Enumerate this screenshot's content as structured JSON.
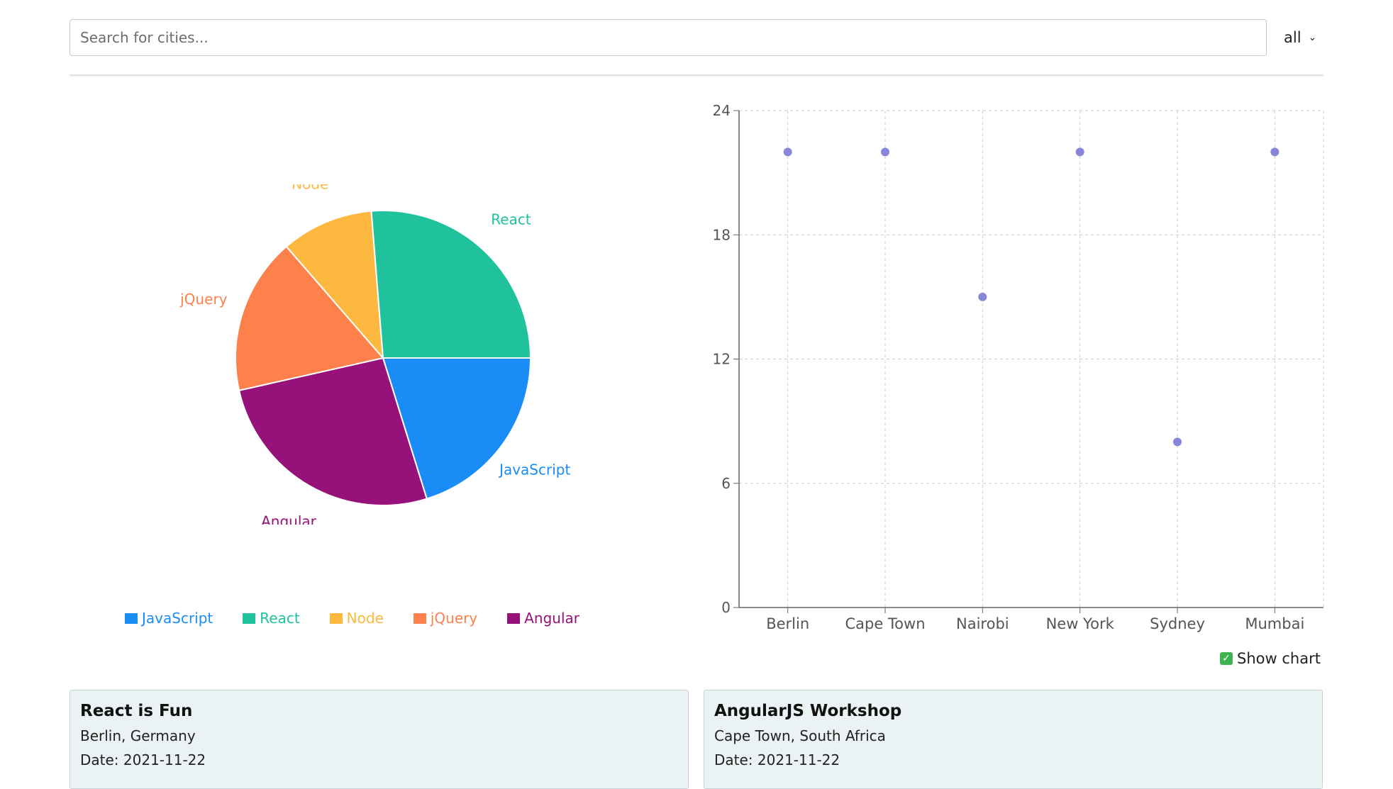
{
  "search": {
    "placeholder": "Search for cities..."
  },
  "filter": {
    "selected": "all"
  },
  "show_chart": {
    "label": "Show chart",
    "checked": true
  },
  "colors": {
    "JavaScript": "#1a8cf6",
    "React": "#20c29e",
    "Node": "#fdb93f",
    "jQuery": "#fe814b",
    "Angular": "#96117a",
    "scatter_point": "#8886d8"
  },
  "chart_data": [
    {
      "type": "pie",
      "slices": [
        {
          "label": "JavaScript",
          "value": 20
        },
        {
          "label": "Angular",
          "value": 26
        },
        {
          "label": "jQuery",
          "value": 17
        },
        {
          "label": "Node",
          "value": 10
        },
        {
          "label": "React",
          "value": 26
        }
      ],
      "legend": [
        "JavaScript",
        "React",
        "Node",
        "jQuery",
        "Angular"
      ],
      "legend_position": "bottom"
    },
    {
      "type": "scatter",
      "categories": [
        "Berlin",
        "Cape Town",
        "Nairobi",
        "New York",
        "Sydney",
        "Mumbai"
      ],
      "values": [
        22,
        22,
        15,
        22,
        8,
        22
      ],
      "ylim": [
        0,
        24
      ],
      "yticks": [
        0,
        6,
        12,
        18,
        24
      ],
      "grid": true
    }
  ],
  "cards": [
    {
      "title": "React is Fun",
      "location": "Berlin, Germany",
      "date": "Date: 2021-11-22"
    },
    {
      "title": "AngularJS Workshop",
      "location": "Cape Town, South Africa",
      "date": "Date: 2021-11-22"
    }
  ]
}
